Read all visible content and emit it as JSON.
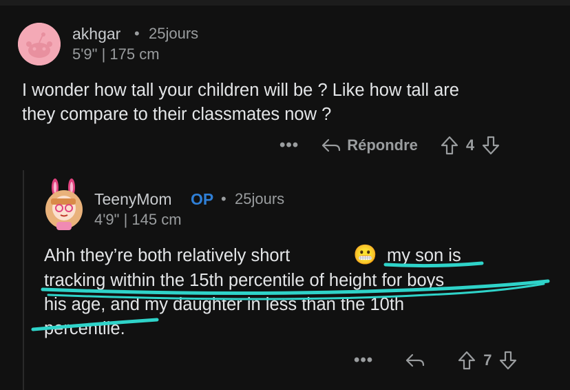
{
  "comments": [
    {
      "author": "akhgar",
      "age": "25jours",
      "flair": "5'9\" | 175 cm",
      "body_line1": "I wonder how tall your children will be ? Like how tall are",
      "body_line2": "they compare to their classmates now ?",
      "more_label": "•••",
      "reply_label": "Répondre",
      "votes": "4"
    },
    {
      "author": "TeenyMom",
      "op_badge": "OP",
      "age": "25jours",
      "flair": "4'9\" | 145 cm",
      "body_line1_a": "Ahh they’re both relatively short",
      "emoji": "😬",
      "body_line1_b": "my son is",
      "body_line2": "tracking within the 15th percentile of height for boys",
      "body_line3": "his age, and my daughter in less than the 10th",
      "body_line4": "percentile.",
      "more_label": "•••",
      "votes": "7"
    }
  ],
  "separator": "•",
  "colors": {
    "background": "#111111",
    "highlight": "#2fd3c9",
    "op_badge": "#2f7fd6"
  }
}
